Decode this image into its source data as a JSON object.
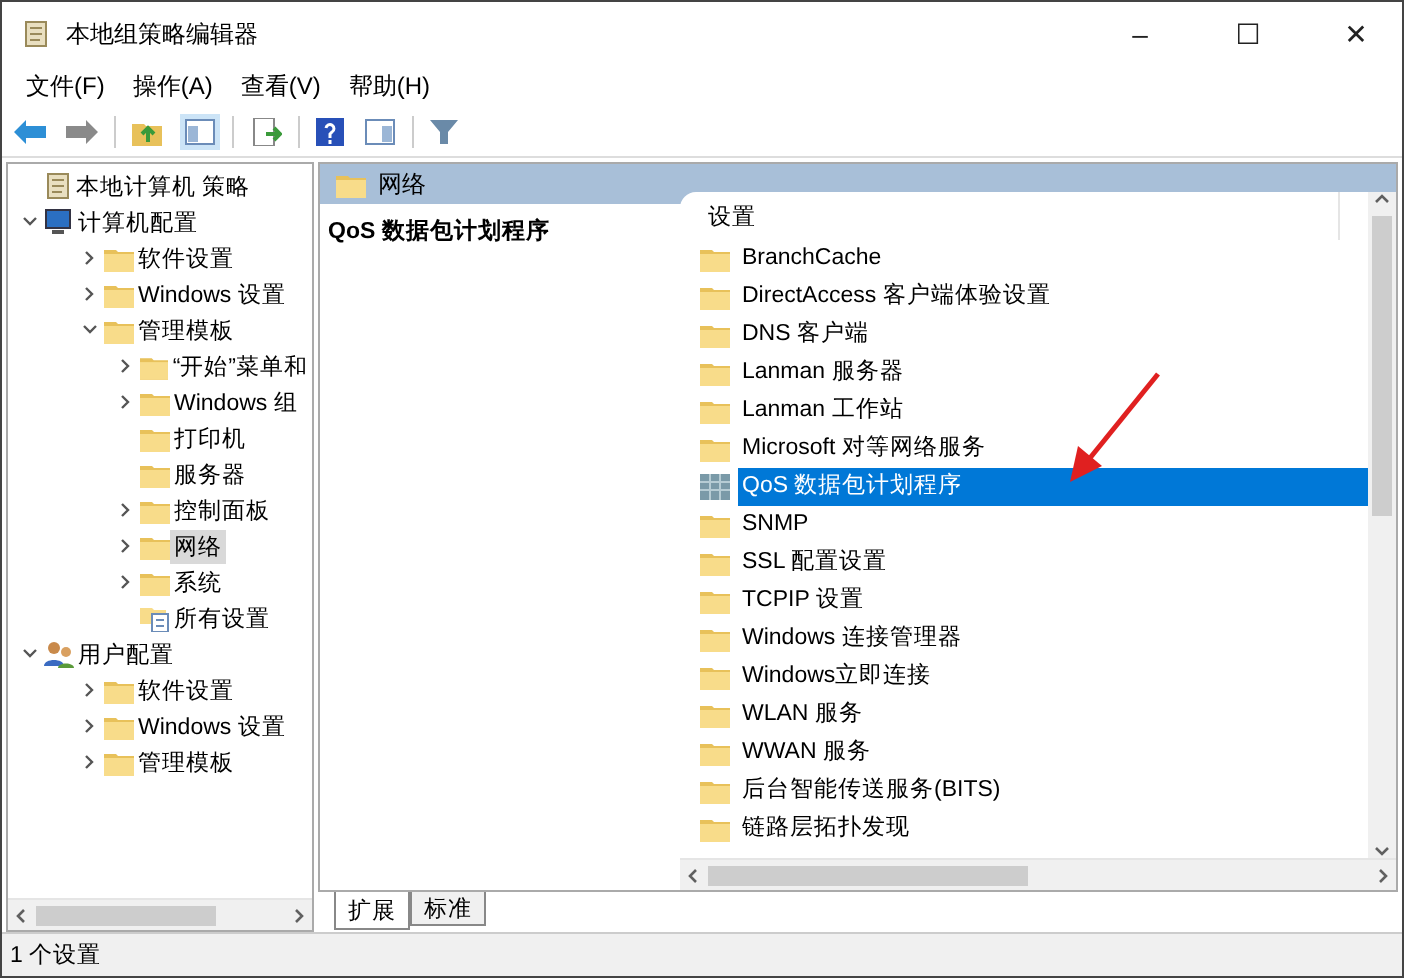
{
  "window": {
    "title": "本地组策略编辑器",
    "controls": [
      "–",
      "☐",
      "✕"
    ]
  },
  "menu": [
    "文件(F)",
    "操作(A)",
    "查看(V)",
    "帮助(H)"
  ],
  "tree": [
    {
      "label": "本地计算机 策略",
      "kind": "policy",
      "selected": false,
      "children": [
        {
          "label": "计算机配置",
          "kind": "computer",
          "expanded": true,
          "selected": false,
          "children": [
            {
              "label": "软件设置",
              "kind": "folder",
              "expanded": false,
              "selected": false
            },
            {
              "label": "Windows 设置",
              "kind": "folder",
              "expanded": false,
              "selected": false
            },
            {
              "label": "管理模板",
              "kind": "folder",
              "expanded": true,
              "selected": false,
              "children": [
                {
                  "label": "“开始”菜单和",
                  "kind": "folder",
                  "expanded": false,
                  "selected": false
                },
                {
                  "label": "Windows 组",
                  "kind": "folder",
                  "expanded": false,
                  "selected": false
                },
                {
                  "label": "打印机",
                  "kind": "folder",
                  "selected": false
                },
                {
                  "label": "服务器",
                  "kind": "folder",
                  "selected": false
                },
                {
                  "label": "控制面板",
                  "kind": "folder",
                  "expanded": false,
                  "selected": false
                },
                {
                  "label": "网络",
                  "kind": "folder",
                  "expanded": false,
                  "selected": true
                },
                {
                  "label": "系统",
                  "kind": "folder",
                  "expanded": false,
                  "selected": false
                },
                {
                  "label": "所有设置",
                  "kind": "settings",
                  "selected": false
                }
              ]
            }
          ]
        },
        {
          "label": "用户配置",
          "kind": "user",
          "expanded": true,
          "selected": false,
          "children": [
            {
              "label": "软件设置",
              "kind": "folder",
              "expanded": false,
              "selected": false
            },
            {
              "label": "Windows 设置",
              "kind": "folder",
              "expanded": false,
              "selected": false
            },
            {
              "label": "管理模板",
              "kind": "folder",
              "expanded": false,
              "selected": false
            }
          ]
        }
      ]
    }
  ],
  "header": {
    "title": "网络"
  },
  "description": {
    "title": "QoS 数据包计划程序"
  },
  "list": {
    "column": "设置",
    "items": [
      {
        "label": "BranchCache",
        "kind": "folder",
        "selected": false
      },
      {
        "label": "DirectAccess 客户端体验设置",
        "kind": "folder",
        "selected": false
      },
      {
        "label": "DNS 客户端",
        "kind": "folder",
        "selected": false
      },
      {
        "label": "Lanman 服务器",
        "kind": "folder",
        "selected": false
      },
      {
        "label": "Lanman 工作站",
        "kind": "folder",
        "selected": false
      },
      {
        "label": "Microsoft 对等网络服务",
        "kind": "folder",
        "selected": false
      },
      {
        "label": "QoS 数据包计划程序",
        "kind": "setting",
        "selected": true
      },
      {
        "label": "SNMP",
        "kind": "folder",
        "selected": false
      },
      {
        "label": "SSL 配置设置",
        "kind": "folder",
        "selected": false
      },
      {
        "label": "TCPIP 设置",
        "kind": "folder",
        "selected": false
      },
      {
        "label": "Windows 连接管理器",
        "kind": "folder",
        "selected": false
      },
      {
        "label": "Windows立即连接",
        "kind": "folder",
        "selected": false
      },
      {
        "label": "WLAN 服务",
        "kind": "folder",
        "selected": false
      },
      {
        "label": "WWAN 服务",
        "kind": "folder",
        "selected": false
      },
      {
        "label": "后台智能传送服务(BITS)",
        "kind": "folder",
        "selected": false
      },
      {
        "label": "链路层拓扑发现",
        "kind": "folder",
        "selected": false
      }
    ]
  },
  "tabs": [
    {
      "label": "扩展",
      "selected": true
    },
    {
      "label": "标准",
      "selected": false
    }
  ],
  "status_bar": {
    "text": "1 个设置"
  }
}
